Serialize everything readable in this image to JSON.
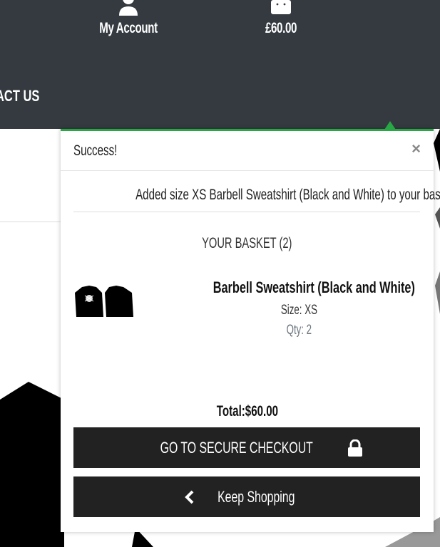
{
  "header": {
    "account_label": "My Account",
    "basket_total": "£60.00",
    "nav_partial": "ACT US"
  },
  "toast": {
    "title": "Success!",
    "close_symbol": "×",
    "message": "Added size XS Barbell Sweatshirt (Black and White) to your basket",
    "basket_heading": "YOUR BASKET (2)",
    "item": {
      "name": "Barbell Sweatshirt (Black and White)",
      "size": "Size: XS",
      "qty": "Qty: 2"
    },
    "total": "Total:$60.00",
    "checkout_label": "GO TO SECURE CHECKOUT",
    "keep_shopping_label": "Keep Shopping",
    "accent_color": "#28a745"
  },
  "icons": [
    "user-icon",
    "shopping-bag-icon",
    "close-icon",
    "lock-icon",
    "chevron-left-icon"
  ]
}
